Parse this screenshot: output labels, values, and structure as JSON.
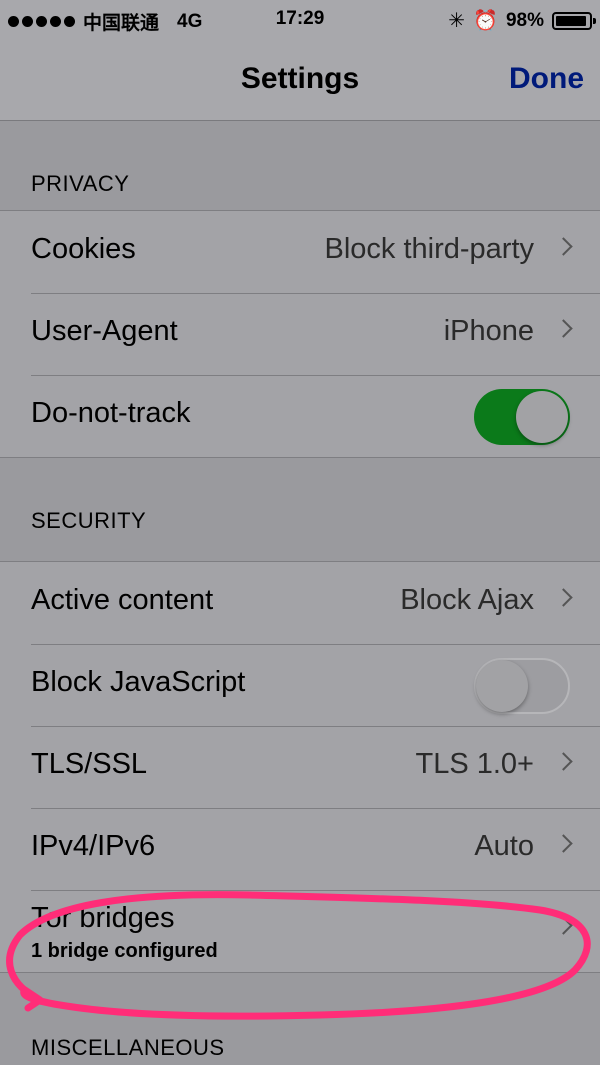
{
  "status_bar": {
    "carrier": "中国联通",
    "network": "4G",
    "time": "17:29",
    "battery": "98%",
    "signal_bars": 5,
    "battery_level": 0.98
  },
  "nav": {
    "title": "Settings",
    "done_label": "Done"
  },
  "colors": {
    "done": "#001a7a",
    "toggle_on": "#0b7a1a",
    "annotation": "#ff2d78"
  },
  "sections": {
    "privacy": {
      "header": "PRIVACY",
      "cookies": {
        "label": "Cookies",
        "value": "Block third-party"
      },
      "user_agent": {
        "label": "User-Agent",
        "value": "iPhone"
      },
      "do_not_track": {
        "label": "Do-not-track",
        "on": true
      }
    },
    "security": {
      "header": "SECURITY",
      "active_content": {
        "label": "Active content",
        "value": "Block Ajax"
      },
      "block_js": {
        "label": "Block JavaScript",
        "on": false
      },
      "tls": {
        "label": "TLS/SSL",
        "value": "TLS 1.0+"
      },
      "ip": {
        "label": "IPv4/IPv6",
        "value": "Auto"
      },
      "tor": {
        "label": "Tor bridges",
        "detail": "1 bridge configured"
      }
    },
    "misc": {
      "header": "MISCELLANEOUS"
    }
  }
}
